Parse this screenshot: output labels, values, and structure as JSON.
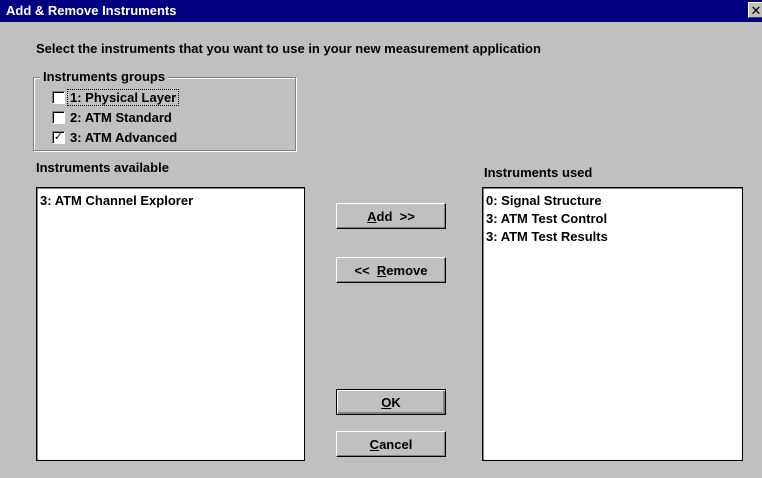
{
  "window": {
    "title": "Add & Remove Instruments",
    "close_glyph": "✕"
  },
  "instruction": "Select the instruments that you want to use in your new measurement application",
  "groups": {
    "legend": "Instruments groups",
    "items": [
      {
        "label": "1:  Physical Layer",
        "checked": false,
        "check_glyph": ""
      },
      {
        "label": "2:  ATM Standard",
        "checked": false,
        "check_glyph": ""
      },
      {
        "label": "3:  ATM Advanced",
        "checked": true,
        "check_glyph": "✓"
      }
    ]
  },
  "available": {
    "label": "Instruments available",
    "items": [
      "3: ATM Channel Explorer"
    ]
  },
  "used": {
    "label": "Instruments used",
    "items": [
      "0: Signal Structure",
      "3: ATM Test Control",
      "3: ATM Test Results"
    ]
  },
  "buttons": {
    "add": {
      "mnemonic": "A",
      "rest": "dd  >>"
    },
    "remove": {
      "prefix": "<<  ",
      "mnemonic": "R",
      "rest": "emove"
    },
    "ok": {
      "mnemonic": "O",
      "rest": "K"
    },
    "cancel": {
      "mnemonic": "C",
      "rest": "ancel"
    }
  }
}
